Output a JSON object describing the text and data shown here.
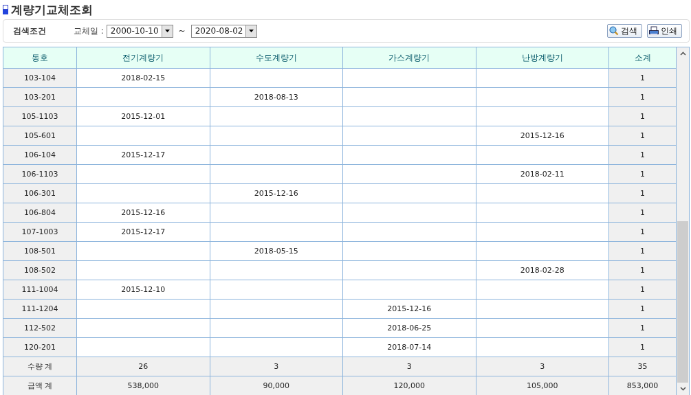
{
  "title": "계량기교체조회",
  "filter": {
    "label": "검색조건",
    "date_label": "교체일 :",
    "from": "2000-10-10",
    "separator": "~",
    "to": "2020-08-02",
    "buttons": [
      "검색",
      "인쇄"
    ]
  },
  "table": {
    "columns": [
      "동호",
      "전기계량기",
      "수도계량기",
      "가스계량기",
      "난방계량기",
      "소계"
    ],
    "rows": [
      {
        "kind": "item",
        "cells": [
          "103-104",
          "2018-02-15",
          "",
          "",
          "",
          "1"
        ]
      },
      {
        "kind": "item",
        "cells": [
          "103-201",
          "",
          "2018-08-13",
          "",
          "",
          "1"
        ]
      },
      {
        "kind": "item",
        "cells": [
          "105-1103",
          "2015-12-01",
          "",
          "",
          "",
          "1"
        ]
      },
      {
        "kind": "item",
        "cells": [
          "105-601",
          "",
          "",
          "",
          "2015-12-16",
          "1"
        ]
      },
      {
        "kind": "item",
        "cells": [
          "106-104",
          "2015-12-17",
          "",
          "",
          "",
          "1"
        ]
      },
      {
        "kind": "item",
        "cells": [
          "106-1103",
          "",
          "",
          "",
          "2018-02-11",
          "1"
        ]
      },
      {
        "kind": "item",
        "cells": [
          "106-301",
          "",
          "2015-12-16",
          "",
          "",
          "1"
        ]
      },
      {
        "kind": "item",
        "cells": [
          "106-804",
          "2015-12-16",
          "",
          "",
          "",
          "1"
        ]
      },
      {
        "kind": "item",
        "cells": [
          "107-1003",
          "2015-12-17",
          "",
          "",
          "",
          "1"
        ]
      },
      {
        "kind": "item",
        "cells": [
          "108-501",
          "",
          "2018-05-15",
          "",
          "",
          "1"
        ]
      },
      {
        "kind": "item",
        "cells": [
          "108-502",
          "",
          "",
          "",
          "2018-02-28",
          "1"
        ]
      },
      {
        "kind": "item",
        "cells": [
          "111-1004",
          "2015-12-10",
          "",
          "",
          "",
          "1"
        ]
      },
      {
        "kind": "item",
        "cells": [
          "111-1204",
          "",
          "",
          "2015-12-16",
          "",
          "1"
        ]
      },
      {
        "kind": "item",
        "cells": [
          "112-502",
          "",
          "",
          "2018-06-25",
          "",
          "1"
        ]
      },
      {
        "kind": "item",
        "cells": [
          "120-201",
          "",
          "",
          "2018-07-14",
          "",
          "1"
        ]
      },
      {
        "kind": "total",
        "cells": [
          "수량 계",
          "26",
          "3",
          "3",
          "3",
          "35"
        ]
      },
      {
        "kind": "total",
        "cells": [
          "금액 계",
          "538,000",
          "90,000",
          "120,000",
          "105,000",
          "853,000"
        ]
      }
    ]
  }
}
